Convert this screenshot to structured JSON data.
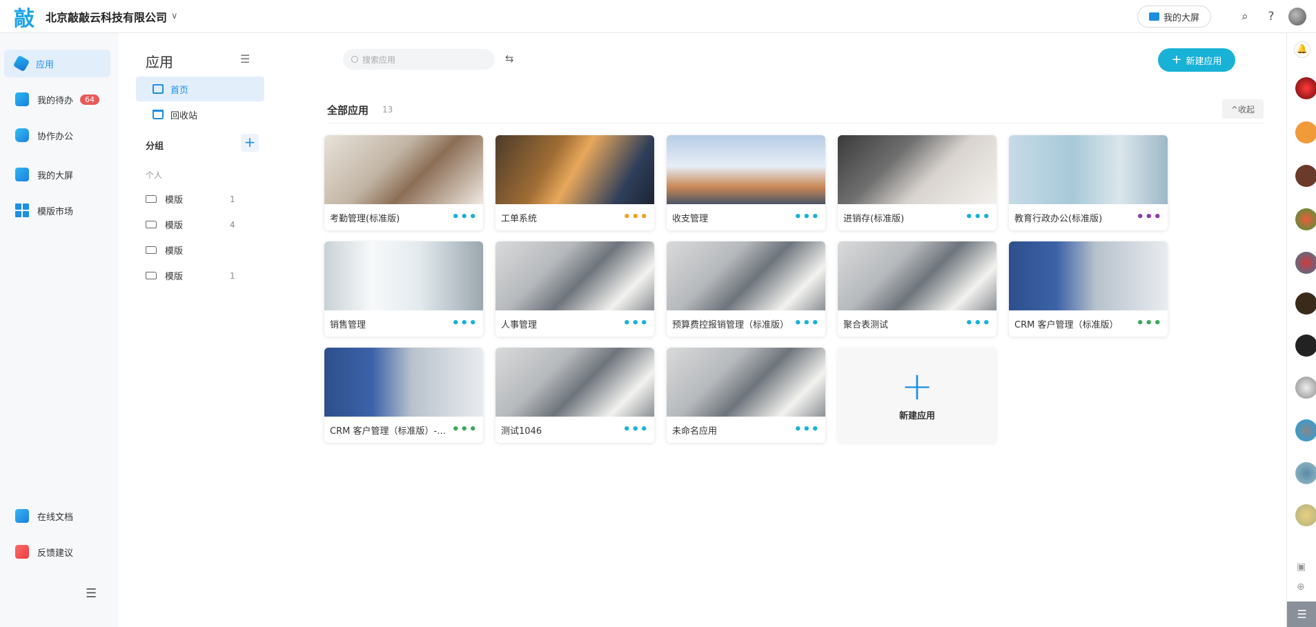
{
  "header": {
    "logo_char": "敲",
    "company": "北京敲敲云科技有限公司",
    "caret": "∨",
    "bigscreen_label": "我的大屏",
    "search_icon": "⌕",
    "help_icon": "?"
  },
  "leftnav": {
    "items": [
      {
        "label": "应用"
      },
      {
        "label": "我的待办",
        "badge": "64"
      },
      {
        "label": "协作办公"
      },
      {
        "label": "我的大屏"
      },
      {
        "label": "模版市场"
      }
    ],
    "bottom": [
      {
        "label": "在线文档"
      },
      {
        "label": "反馈建议"
      }
    ],
    "collapse_icon": "☰"
  },
  "panel2": {
    "title": "应用",
    "collapse_icon": "☰",
    "items": [
      {
        "label": "首页"
      },
      {
        "label": "回收站"
      }
    ],
    "group_label": "分组",
    "add": "+",
    "personal_label": "个人",
    "folders": [
      {
        "label": "模版",
        "count": "1"
      },
      {
        "label": "模版",
        "count": "4"
      },
      {
        "label": "模版",
        "count": ""
      },
      {
        "label": "模版",
        "count": "1"
      }
    ]
  },
  "main": {
    "search_placeholder": "搜索应用",
    "filter_icon": "⇆",
    "new_button": "新建应用",
    "new_plus": "+",
    "all_title": "全部应用",
    "all_count": "13",
    "fold_label": "^收起",
    "dots": "•••",
    "cards": [
      {
        "name": "考勤管理(标准版)",
        "dot_color": "#17b2d6"
      },
      {
        "name": "工单系统",
        "dot_color": "#f0a020"
      },
      {
        "name": "收支管理",
        "dot_color": "#17b2d6"
      },
      {
        "name": "进销存(标准版)",
        "dot_color": "#17b2d6"
      },
      {
        "name": "教育行政办公(标准版)",
        "dot_color": "#8a3aa8"
      },
      {
        "name": "销售管理",
        "dot_color": "#17b2d6"
      },
      {
        "name": "人事管理",
        "dot_color": "#17b2d6"
      },
      {
        "name": "预算费控报销管理（标准版）",
        "dot_color": "#17b2d6"
      },
      {
        "name": "聚合表测试",
        "dot_color": "#17b2d6"
      },
      {
        "name": "CRM 客户管理（标准版）",
        "dot_color": "#3aa85a"
      },
      {
        "name": "CRM 客户管理（标准版）-复...",
        "dot_color": "#3aa85a"
      },
      {
        "name": "测试1046",
        "dot_color": "#17b2d6"
      },
      {
        "name": "未命名应用",
        "dot_color": "#17b2d6"
      }
    ],
    "new_card_plus": "+",
    "new_card_label": "新建应用"
  },
  "rail": {
    "bell_icon": "🔔",
    "menu_icon": "☰",
    "save_icon": "▣",
    "add_icon": "⊕"
  }
}
